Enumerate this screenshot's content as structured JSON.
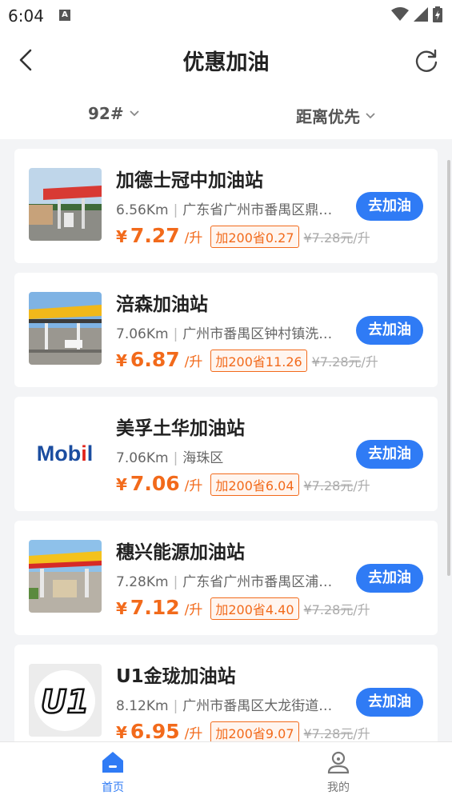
{
  "status_bar": {
    "time": "6:04",
    "app_icon_letter": "A"
  },
  "header": {
    "title": "优惠加油"
  },
  "filters": {
    "fuel": "92#",
    "sort": "距离优先"
  },
  "colors": {
    "accent": "#2f7bf5",
    "price": "#f26a1b"
  },
  "stations": [
    {
      "name": "加德士冠中加油站",
      "distance": "6.56Km",
      "address": "广东省广州市番禺区鼎…",
      "currency": "¥",
      "price": "7.27",
      "unit": "/升",
      "discount": "加200省0.27",
      "orig_price": "¥7.28元",
      "orig_unit": "/升",
      "button": "去加油",
      "thumb": "station-photo-red"
    },
    {
      "name": "涪森加油站",
      "distance": "7.06Km",
      "address": "广州市番禺区钟村镇洗…",
      "currency": "¥",
      "price": "6.87",
      "unit": "/升",
      "discount": "加200省11.26",
      "orig_price": "¥7.28元",
      "orig_unit": "/升",
      "button": "去加油",
      "thumb": "station-photo-yellow"
    },
    {
      "name": "美孚土华加油站",
      "distance": "7.06Km",
      "address": "海珠区",
      "currency": "¥",
      "price": "7.06",
      "unit": "/升",
      "discount": "加200省6.04",
      "orig_price": "¥7.28元",
      "orig_unit": "/升",
      "button": "去加油",
      "thumb": "mobil-logo",
      "logo_text": "Mobil"
    },
    {
      "name": "穗兴能源加油站",
      "distance": "7.28Km",
      "address": "广东省广州市番禺区浦…",
      "currency": "¥",
      "price": "7.12",
      "unit": "/升",
      "discount": "加200省4.40",
      "orig_price": "¥7.28元",
      "orig_unit": "/升",
      "button": "去加油",
      "thumb": "station-photo-shell"
    },
    {
      "name": "U1金珑加油站",
      "distance": "8.12Km",
      "address": "广州市番禺区大龙街道…",
      "currency": "¥",
      "price": "6.95",
      "unit": "/升",
      "discount": "加200省9.07",
      "orig_price": "¥7.28元",
      "orig_unit": "/升",
      "button": "去加油",
      "thumb": "u1-logo",
      "logo_text": "U1"
    }
  ],
  "tabbar": {
    "home": "首页",
    "mine": "我的"
  }
}
